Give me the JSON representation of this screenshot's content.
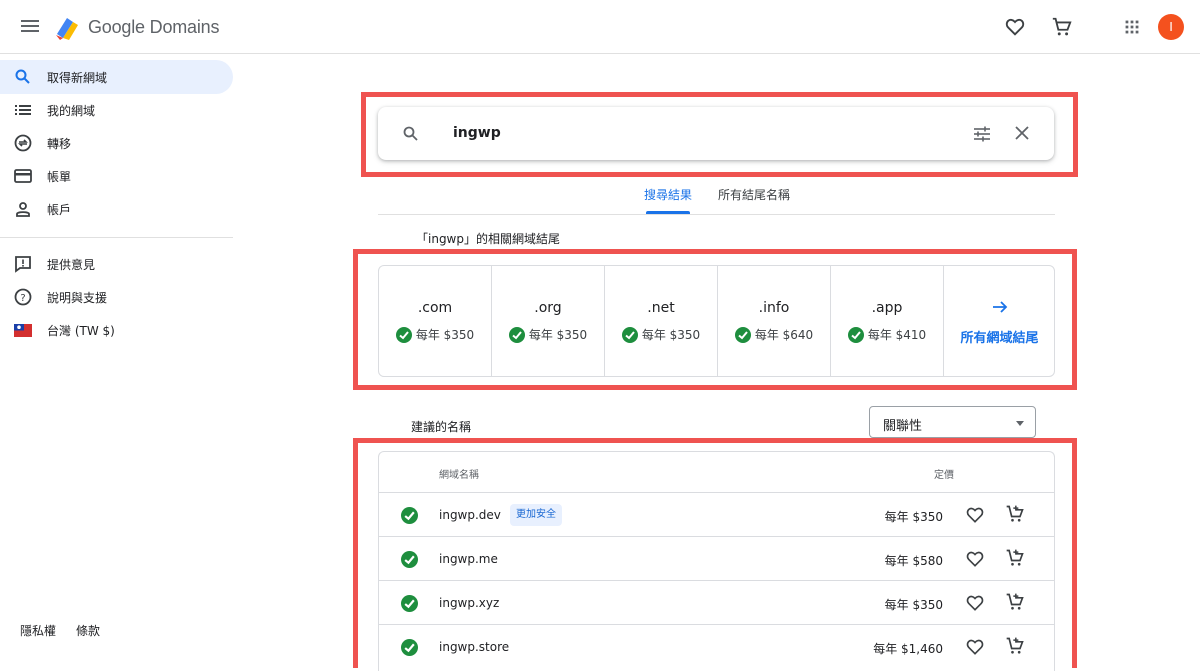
{
  "header": {
    "brand": "Google Domains",
    "avatar_initial": "I"
  },
  "sidebar": {
    "items": [
      {
        "label": "取得新網域",
        "icon": "search-icon",
        "active": true
      },
      {
        "label": "我的網域",
        "icon": "list-icon"
      },
      {
        "label": "轉移",
        "icon": "transfer-icon"
      },
      {
        "label": "帳單",
        "icon": "credit-card-icon"
      },
      {
        "label": "帳戶",
        "icon": "person-icon"
      }
    ],
    "secondary_items": [
      {
        "label": "提供意見",
        "icon": "feedback-icon"
      },
      {
        "label": "說明與支援",
        "icon": "help-icon"
      },
      {
        "label": "台灣 (TW $)",
        "icon": "taiwan-flag-icon"
      }
    ],
    "footer": {
      "privacy": "隱私權",
      "terms": "條款"
    }
  },
  "search": {
    "query": "ingwp"
  },
  "tabs": [
    {
      "label": "搜尋結果",
      "active": true
    },
    {
      "label": "所有結尾名稱",
      "active": false
    }
  ],
  "tld_section": {
    "title": "「ingwp」的相關網域結尾",
    "items": [
      {
        "tld": ".com",
        "price": "每年 $350"
      },
      {
        "tld": ".org",
        "price": "每年 $350"
      },
      {
        "tld": ".net",
        "price": "每年 $350"
      },
      {
        "tld": ".info",
        "price": "每年 $640"
      },
      {
        "tld": ".app",
        "price": "每年 $410"
      }
    ],
    "all_label": "所有網域結尾"
  },
  "suggestions": {
    "title": "建議的名稱",
    "sort_value": "關聯性",
    "columns": {
      "domain": "網域名稱",
      "price": "定價"
    },
    "rows": [
      {
        "domain": "ingwp.dev",
        "badge": "更加安全",
        "price": "每年 $350"
      },
      {
        "domain": "ingwp.me",
        "badge": "",
        "price": "每年 $580"
      },
      {
        "domain": "ingwp.xyz",
        "badge": "",
        "price": "每年 $350"
      },
      {
        "domain": "ingwp.store",
        "badge": "",
        "price": "每年 $1,460"
      }
    ]
  },
  "colors": {
    "accent": "#1a73e8",
    "available": "#1e8e3e",
    "highlight_box": "#ef5350",
    "avatar": "#f4511e"
  }
}
